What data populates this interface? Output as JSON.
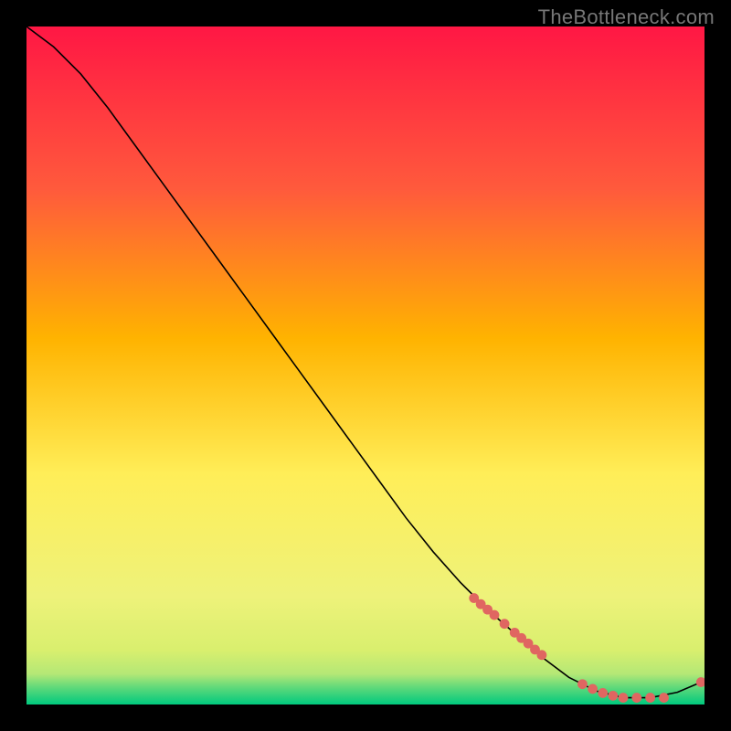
{
  "watermark": "TheBottleneck.com",
  "chart_data": {
    "type": "line",
    "title": "",
    "xlabel": "",
    "ylabel": "",
    "xlim": [
      0,
      100
    ],
    "ylim": [
      0,
      100
    ],
    "x": [
      0,
      4,
      8,
      12,
      16,
      20,
      24,
      28,
      32,
      36,
      40,
      44,
      48,
      52,
      56,
      60,
      64,
      68,
      72,
      76,
      80,
      84,
      88,
      92,
      96,
      100
    ],
    "y": [
      100,
      97,
      93,
      88,
      82.5,
      77,
      71.5,
      66,
      60.5,
      55,
      49.5,
      44,
      38.5,
      33,
      27.5,
      22.5,
      18,
      14,
      10.5,
      7,
      4,
      2,
      1,
      1,
      1.8,
      3.5
    ],
    "markers": {
      "x": [
        66,
        67,
        68,
        69,
        70.5,
        72,
        73,
        74,
        75,
        76,
        82,
        83.5,
        85,
        86.5,
        88,
        90,
        92,
        94,
        99.5
      ],
      "y": [
        15.7,
        14.8,
        14.0,
        13.2,
        11.9,
        10.6,
        9.8,
        9.0,
        8.1,
        7.3,
        3.0,
        2.3,
        1.7,
        1.3,
        1.0,
        1.0,
        1.0,
        1.0,
        3.3
      ]
    },
    "gradient_colors": {
      "top": "#ff1744",
      "upper_mid": "#ff6d3a",
      "mid": "#ffb300",
      "lower_mid": "#ffee58",
      "lower": "#eef27a",
      "band1": "#b4e876",
      "band2": "#5fd97a",
      "bottom": "#00c97e"
    },
    "marker_color": "#e06661",
    "line_color": "#000000"
  }
}
